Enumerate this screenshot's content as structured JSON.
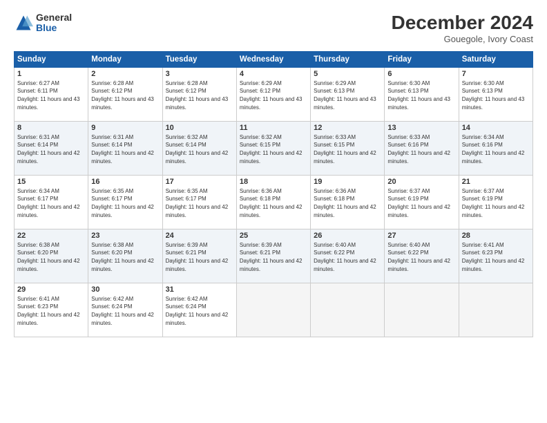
{
  "logo": {
    "general": "General",
    "blue": "Blue"
  },
  "header": {
    "month": "December 2024",
    "location": "Gouegole, Ivory Coast"
  },
  "weekdays": [
    "Sunday",
    "Monday",
    "Tuesday",
    "Wednesday",
    "Thursday",
    "Friday",
    "Saturday"
  ],
  "weeks": [
    [
      {
        "day": "1",
        "sunrise": "6:27 AM",
        "sunset": "6:11 PM",
        "daylight": "11 hours and 43 minutes."
      },
      {
        "day": "2",
        "sunrise": "6:28 AM",
        "sunset": "6:12 PM",
        "daylight": "11 hours and 43 minutes."
      },
      {
        "day": "3",
        "sunrise": "6:28 AM",
        "sunset": "6:12 PM",
        "daylight": "11 hours and 43 minutes."
      },
      {
        "day": "4",
        "sunrise": "6:29 AM",
        "sunset": "6:12 PM",
        "daylight": "11 hours and 43 minutes."
      },
      {
        "day": "5",
        "sunrise": "6:29 AM",
        "sunset": "6:13 PM",
        "daylight": "11 hours and 43 minutes."
      },
      {
        "day": "6",
        "sunrise": "6:30 AM",
        "sunset": "6:13 PM",
        "daylight": "11 hours and 43 minutes."
      },
      {
        "day": "7",
        "sunrise": "6:30 AM",
        "sunset": "6:13 PM",
        "daylight": "11 hours and 43 minutes."
      }
    ],
    [
      {
        "day": "8",
        "sunrise": "6:31 AM",
        "sunset": "6:14 PM",
        "daylight": "11 hours and 42 minutes."
      },
      {
        "day": "9",
        "sunrise": "6:31 AM",
        "sunset": "6:14 PM",
        "daylight": "11 hours and 42 minutes."
      },
      {
        "day": "10",
        "sunrise": "6:32 AM",
        "sunset": "6:14 PM",
        "daylight": "11 hours and 42 minutes."
      },
      {
        "day": "11",
        "sunrise": "6:32 AM",
        "sunset": "6:15 PM",
        "daylight": "11 hours and 42 minutes."
      },
      {
        "day": "12",
        "sunrise": "6:33 AM",
        "sunset": "6:15 PM",
        "daylight": "11 hours and 42 minutes."
      },
      {
        "day": "13",
        "sunrise": "6:33 AM",
        "sunset": "6:16 PM",
        "daylight": "11 hours and 42 minutes."
      },
      {
        "day": "14",
        "sunrise": "6:34 AM",
        "sunset": "6:16 PM",
        "daylight": "11 hours and 42 minutes."
      }
    ],
    [
      {
        "day": "15",
        "sunrise": "6:34 AM",
        "sunset": "6:17 PM",
        "daylight": "11 hours and 42 minutes."
      },
      {
        "day": "16",
        "sunrise": "6:35 AM",
        "sunset": "6:17 PM",
        "daylight": "11 hours and 42 minutes."
      },
      {
        "day": "17",
        "sunrise": "6:35 AM",
        "sunset": "6:17 PM",
        "daylight": "11 hours and 42 minutes."
      },
      {
        "day": "18",
        "sunrise": "6:36 AM",
        "sunset": "6:18 PM",
        "daylight": "11 hours and 42 minutes."
      },
      {
        "day": "19",
        "sunrise": "6:36 AM",
        "sunset": "6:18 PM",
        "daylight": "11 hours and 42 minutes."
      },
      {
        "day": "20",
        "sunrise": "6:37 AM",
        "sunset": "6:19 PM",
        "daylight": "11 hours and 42 minutes."
      },
      {
        "day": "21",
        "sunrise": "6:37 AM",
        "sunset": "6:19 PM",
        "daylight": "11 hours and 42 minutes."
      }
    ],
    [
      {
        "day": "22",
        "sunrise": "6:38 AM",
        "sunset": "6:20 PM",
        "daylight": "11 hours and 42 minutes."
      },
      {
        "day": "23",
        "sunrise": "6:38 AM",
        "sunset": "6:20 PM",
        "daylight": "11 hours and 42 minutes."
      },
      {
        "day": "24",
        "sunrise": "6:39 AM",
        "sunset": "6:21 PM",
        "daylight": "11 hours and 42 minutes."
      },
      {
        "day": "25",
        "sunrise": "6:39 AM",
        "sunset": "6:21 PM",
        "daylight": "11 hours and 42 minutes."
      },
      {
        "day": "26",
        "sunrise": "6:40 AM",
        "sunset": "6:22 PM",
        "daylight": "11 hours and 42 minutes."
      },
      {
        "day": "27",
        "sunrise": "6:40 AM",
        "sunset": "6:22 PM",
        "daylight": "11 hours and 42 minutes."
      },
      {
        "day": "28",
        "sunrise": "6:41 AM",
        "sunset": "6:23 PM",
        "daylight": "11 hours and 42 minutes."
      }
    ],
    [
      {
        "day": "29",
        "sunrise": "6:41 AM",
        "sunset": "6:23 PM",
        "daylight": "11 hours and 42 minutes."
      },
      {
        "day": "30",
        "sunrise": "6:42 AM",
        "sunset": "6:24 PM",
        "daylight": "11 hours and 42 minutes."
      },
      {
        "day": "31",
        "sunrise": "6:42 AM",
        "sunset": "6:24 PM",
        "daylight": "11 hours and 42 minutes."
      },
      null,
      null,
      null,
      null
    ]
  ]
}
